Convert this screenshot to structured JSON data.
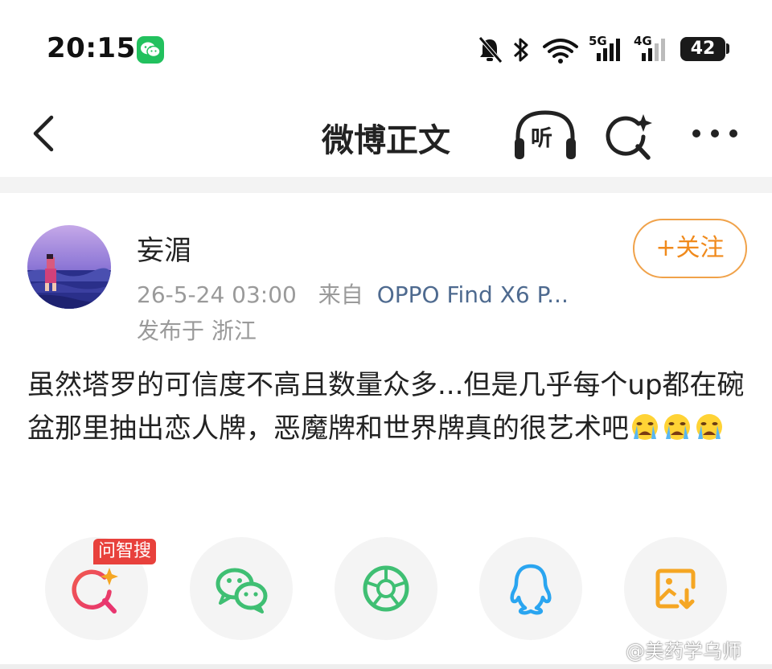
{
  "status_bar": {
    "time": "20:15",
    "network_5g": "5G",
    "network_4g": "4G",
    "battery": "42",
    "icons": [
      "wechat-icon",
      "mute-bell-icon",
      "bluetooth-icon",
      "wifi-icon",
      "signal-icon",
      "battery-icon"
    ]
  },
  "nav": {
    "title": "微博正文",
    "listen_label": "听",
    "icons": [
      "back-arrow-icon",
      "headphones-icon",
      "sparkle-search-icon",
      "more-dots-icon"
    ]
  },
  "post": {
    "author": "妄湄",
    "timestamp": "26-5-24 03:00",
    "source_prefix": "来自",
    "source": "OPPO Find X6 P...",
    "location": "发布于 浙江",
    "follow_label": "+关注",
    "body": "虽然塔罗的可信度不高且数量众多...但是几乎每个up都在碗盆那里抽出恋人牌，恶魔牌和世界牌真的很艺术吧",
    "emojis": [
      "crying-emoji",
      "crying-emoji",
      "crying-emoji"
    ]
  },
  "share": {
    "badge": "问智搜",
    "icons": [
      "ai-search-icon",
      "wechat-icon",
      "moments-icon",
      "qq-icon",
      "save-image-icon"
    ]
  },
  "watermark": "@美药学乌师",
  "colors": {
    "accent_orange": "#f08a1c",
    "link_blue": "#4e6a8f",
    "badge_red": "#e8413c",
    "wechat_green": "#22c15e"
  }
}
